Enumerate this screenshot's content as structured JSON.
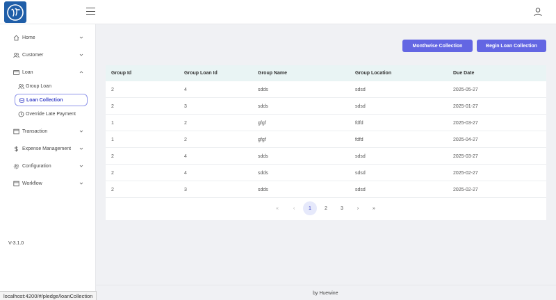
{
  "header": {
    "logo_icon": "brand-logo",
    "menu_icon": "hamburger-icon",
    "user_icon": "user-icon"
  },
  "sidebar": {
    "items": [
      {
        "label": "Home",
        "icon": "home-icon",
        "chevron": "down"
      },
      {
        "label": "Customer",
        "icon": "users-icon",
        "chevron": "down"
      },
      {
        "label": "Loan",
        "icon": "card-icon",
        "chevron": "up"
      },
      {
        "label": "Transaction",
        "icon": "window-icon",
        "chevron": "down"
      },
      {
        "label": "Expense Management",
        "icon": "dollar-icon",
        "chevron": "down"
      },
      {
        "label": "Configuration",
        "icon": "gear-icon",
        "chevron": "down"
      },
      {
        "label": "Workflow",
        "icon": "window-icon",
        "chevron": "down"
      }
    ],
    "subitems": [
      {
        "label": "Group Loan",
        "icon": "users-icon"
      },
      {
        "label": "Loan Collection",
        "icon": "coins-icon",
        "active": true
      },
      {
        "label": "Override Late Payment",
        "icon": "clock-icon"
      }
    ],
    "version": "V-3.1.0"
  },
  "actions": {
    "monthwise_label": "Monthwise Collection",
    "begin_label": "Begin Loan Collection"
  },
  "table": {
    "columns": [
      "Group Id",
      "Group Loan Id",
      "Group Name",
      "Group Location",
      "Due Date"
    ],
    "rows": [
      [
        "2",
        "4",
        "sdds",
        "sdsd",
        "2025-05-27"
      ],
      [
        "2",
        "3",
        "sdds",
        "sdsd",
        "2025-01-27"
      ],
      [
        "1",
        "2",
        "gfgf",
        "fdfd",
        "2025-03-27"
      ],
      [
        "1",
        "2",
        "gfgf",
        "fdfd",
        "2025-04-27"
      ],
      [
        "2",
        "4",
        "sdds",
        "sdsd",
        "2025-03-27"
      ],
      [
        "2",
        "4",
        "sdds",
        "sdsd",
        "2025-02-27"
      ],
      [
        "2",
        "3",
        "sdds",
        "sdsd",
        "2025-02-27"
      ]
    ]
  },
  "pagination": {
    "first": "«",
    "prev": "‹",
    "pages": [
      "1",
      "2",
      "3"
    ],
    "current": "1",
    "next": "›",
    "last": "»"
  },
  "footer": {
    "text": "by  Huewine"
  },
  "status_url": "localhost:4200/#/pledge/loanCollection",
  "colors": {
    "accent": "#6366e3",
    "table_header": "#e9f4f4",
    "logo_bg": "#1f5ea8"
  }
}
